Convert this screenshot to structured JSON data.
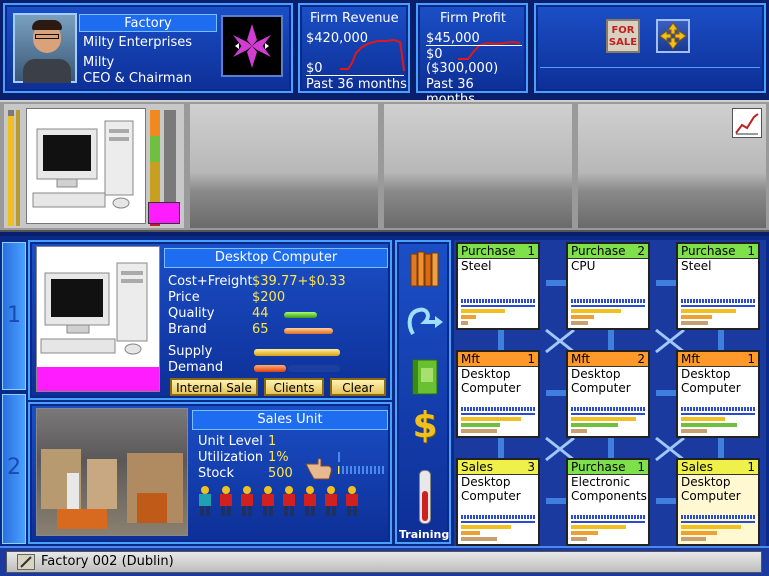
{
  "profile": {
    "company_type": "Factory",
    "company": "Milty Enterprises",
    "name": "Milty",
    "title": "CEO & Chairman"
  },
  "revenue": {
    "title": "Firm Revenue",
    "top": "$420,000",
    "bottom": "$0",
    "period": "Past 36 months"
  },
  "profit": {
    "title": "Firm Profit",
    "top": "$45,000",
    "zero": "$0",
    "bottom": "($300,000)",
    "period": "Past 36 months"
  },
  "top_tools": {
    "for_sale_line1": "FOR",
    "for_sale_line2": "SALE"
  },
  "product": {
    "title": "Desktop Computer",
    "rows": [
      {
        "label": "Cost+Freight",
        "value": "$39.77+$0.33"
      },
      {
        "label": "Price",
        "value": "$200"
      },
      {
        "label": "Quality",
        "value": "44"
      },
      {
        "label": "Brand",
        "value": "65"
      }
    ],
    "quality_level": 0.44,
    "brand_level": 0.65,
    "supply_label": "Supply",
    "demand_label": "Demand",
    "buttons": {
      "internal_sale": "Internal Sale",
      "clients": "Clients",
      "clear": "Clear"
    }
  },
  "unit": {
    "title": "Sales Unit",
    "rows": [
      {
        "label": "Unit Level",
        "value": "1"
      },
      {
        "label": "Utilization",
        "value": "1%"
      },
      {
        "label": "Stock",
        "value": "500"
      }
    ],
    "utilization": 0.01,
    "staff_count": 8
  },
  "side_tools": {
    "training_label": "Training"
  },
  "grid_cards": [
    {
      "type": "Purchase",
      "level": "1",
      "line1": "Steel",
      "line2": "",
      "color": "#7ee04a"
    },
    {
      "type": "Purchase",
      "level": "2",
      "line1": "CPU",
      "line2": "",
      "color": "#7ee04a"
    },
    {
      "type": "Purchase",
      "level": "1",
      "line1": "Steel",
      "line2": "",
      "color": "#7ee04a"
    },
    {
      "type": "Mft",
      "level": "1",
      "line1": "Desktop",
      "line2": "Computer",
      "color": "#ff9a2a"
    },
    {
      "type": "Mft",
      "level": "2",
      "line1": "Desktop",
      "line2": "Computer",
      "color": "#ff9a2a"
    },
    {
      "type": "Mft",
      "level": "1",
      "line1": "Desktop",
      "line2": "Computer",
      "color": "#ff9a2a"
    },
    {
      "type": "Sales",
      "level": "3",
      "line1": "Desktop",
      "line2": "Computer",
      "color": "#f0f04a"
    },
    {
      "type": "Purchase",
      "level": "1",
      "line1": "Electronic",
      "line2": "Components",
      "color": "#7ee04a"
    },
    {
      "type": "Sales",
      "level": "1",
      "line1": "Desktop",
      "line2": "Computer",
      "color": "#f0f04a"
    }
  ],
  "statusbar": {
    "text": "Factory 002 (Dublin)"
  },
  "tabs": {
    "tab1": "1",
    "tab2": "2"
  }
}
